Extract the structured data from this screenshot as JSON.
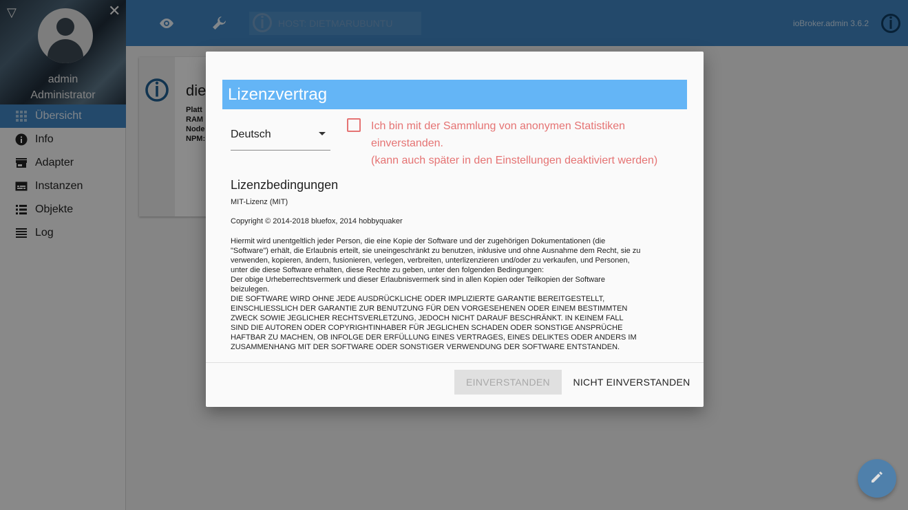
{
  "sidebar": {
    "user_name": "admin",
    "user_role": "Administrator",
    "items": [
      {
        "label": "Übersicht",
        "icon": "grid-icon",
        "active": true
      },
      {
        "label": "Info",
        "icon": "info-icon"
      },
      {
        "label": "Adapter",
        "icon": "store-icon"
      },
      {
        "label": "Instanzen",
        "icon": "instances-icon"
      },
      {
        "label": "Objekte",
        "icon": "list-icon"
      },
      {
        "label": "Log",
        "icon": "log-icon"
      }
    ]
  },
  "topbar": {
    "host_label": "HOST: DIETMARUBUNTU",
    "version": "ioBroker.admin 3.6.2"
  },
  "background_card": {
    "title": "die",
    "labels": [
      "Platt",
      "RAM",
      "Node",
      "NPM:"
    ]
  },
  "dialog": {
    "title": "Lizenzvertrag",
    "language": "Deutsch",
    "stats_line1": "Ich bin mit der Sammlung von anonymen Statistiken",
    "stats_line2": "einverstanden.",
    "stats_line3": "(kann auch später in den Einstellungen deaktiviert werden)",
    "terms_title": "Lizenzbedingungen",
    "license_name": "MIT-Lizenz (MIT)",
    "copyright": "Copyright © 2014-2018 bluefox, 2014 hobbyquaker",
    "license_body": "Hiermit wird unentgeltlich jeder Person, die eine Kopie der Software und der zugehörigen Dokumentationen (die\n\"Software\") erhält, die Erlaubnis erteilt, sie uneingeschränkt zu benutzen, inklusive und ohne Ausnahme dem Recht, sie zu\nverwenden, kopieren, ändern, fusionieren, verlegen, verbreiten, unterlizenzieren und/oder zu verkaufen, und Personen,\nunter die diese Software erhalten, diese Rechte zu geben, unter den folgenden Bedingungen:\nDer obige Urheberrechtsvermerk und dieser Erlaubnisvermerk sind in allen Kopien oder Teilkopien der Software\nbeizulegen.\nDIE SOFTWARE WIRD OHNE JEDE AUSDRÜCKLICHE ODER IMPLIZIERTE GARANTIE BEREITGESTELLT,\nEINSCHLIESSLICH DER GARANTIE ZUR BENUTZUNG FÜR DEN VORGESEHENEN ODER EINEM BESTIMMTEN\nZWECK SOWIE JEGLICHER RECHTSVERLETZUNG, JEDOCH NICHT DARAUF BESCHRÄNKT. IN KEINEM FALL\nSIND DIE AUTOREN ODER COPYRIGHTINHABER FÜR JEGLICHEN SCHADEN ODER SONSTIGE ANSPRÜCHE\nHAFTBAR ZU MACHEN, OB INFOLGE DER ERFÜLLUNG EINES VERTRAGES, EINES DELIKTES ODER ANDERS IM\nZUSAMMENHANG MIT DER SOFTWARE ODER SONSTIGER VERWENDUNG DER SOFTWARE ENTSTANDEN.",
    "agree_label": "EINVERSTANDEN",
    "disagree_label": "NICHT EINVERSTANDEN"
  },
  "colors": {
    "primary": "#3d7fb8",
    "dialog_header": "#64b5f6",
    "warning_text": "#e57373"
  }
}
